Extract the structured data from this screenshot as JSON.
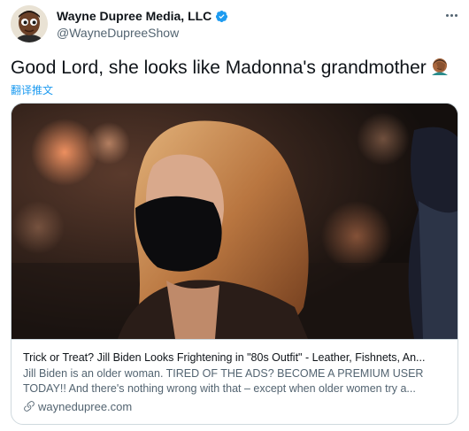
{
  "author": {
    "display_name": "Wayne Dupree Media, LLC",
    "handle": "@WayneDupreeShow",
    "avatar_icon": "cartoon-avatar-icon",
    "verified_icon": "verified-badge-icon"
  },
  "menu": {
    "icon": "more-options-icon"
  },
  "tweet": {
    "text": "Good Lord, she looks like Madonna's grandmother",
    "emoji_icon": "facepalm-emoji-icon",
    "translate_label": "翻译推文"
  },
  "card": {
    "title": "Trick or Treat? Jill Biden Looks Frightening in \"80s Outfit\" - Leather, Fishnets, An...",
    "description_line1": "Jill Biden is an older woman. TIRED OF THE ADS? BECOME A PREMIUM USER",
    "description_line2": "TODAY!! And there's nothing wrong with that – except when older women try a...",
    "domain": "waynedupree.com",
    "link_icon": "link-icon"
  },
  "colors": {
    "accent": "#1d9bf0",
    "text": "#0f1419",
    "secondary": "#536471",
    "border": "#cfd9de"
  }
}
